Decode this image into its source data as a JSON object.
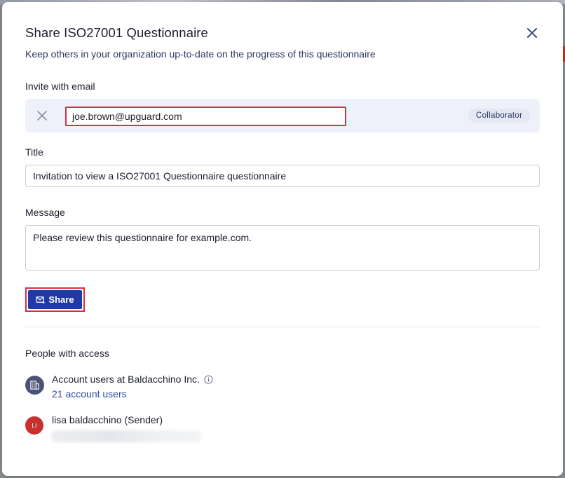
{
  "modal": {
    "title": "Share ISO27001 Questionnaire",
    "subtitle": "Keep others in your organization up-to-date on the progress of this questionnaire",
    "close_icon": "close-icon"
  },
  "invite": {
    "label": "Invite with email",
    "email_value": "joe.brown@upguard.com",
    "role": "Collaborator",
    "remove_icon": "close-icon"
  },
  "title_field": {
    "label": "Title",
    "value": "Invitation to view a ISO27001 Questionnaire questionnaire"
  },
  "message_field": {
    "label": "Message",
    "value": "Please review this questionnaire for example.com."
  },
  "share_button": {
    "label": "Share",
    "icon": "mail-icon"
  },
  "people": {
    "heading": "People with access",
    "org": {
      "name": "Account users at Baldacchino Inc.",
      "link": "21 account users",
      "icon": "building-icon"
    },
    "sender": {
      "initials": "LI",
      "name": "lisa baldacchino (Sender)"
    }
  },
  "colors": {
    "primary": "#1f3aa6",
    "highlight": "#e0284b",
    "link": "#2f4aa8",
    "avatar_sender": "#c93030",
    "avatar_org": "#4a5377"
  }
}
